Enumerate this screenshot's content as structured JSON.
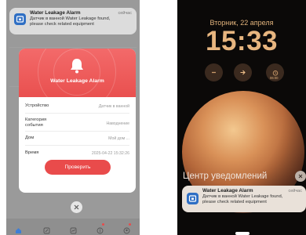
{
  "left": {
    "notification": {
      "title": "Water Leakage Alarm",
      "time": "сейчас",
      "body_line1": "Датчик в ванной Water Leakage found,",
      "body_line2": "please check related equipment"
    },
    "modal": {
      "title": "Water Leakage Alarm",
      "rows": [
        {
          "label": "Устройство",
          "value": "Датчик в ванной"
        },
        {
          "label": "Категория",
          "label2": "события",
          "value": "Наводнение"
        },
        {
          "label": "Дом",
          "value": "Мой дом ..."
        },
        {
          "label": "Время",
          "value": "2025-04-22 15:32:26"
        }
      ],
      "button": "Проверить"
    },
    "tabbar_icons": [
      "home-icon",
      "scene-icon",
      "stats-icon",
      "mall-icon",
      "profile-icon"
    ]
  },
  "right": {
    "date": "Вторник, 22 апреля",
    "time": "15:33",
    "widget_time": "06:00",
    "notification_center_label": "Центр уведомлений",
    "notification": {
      "title": "Water Leakage Alarm",
      "time": "сейчас",
      "body_line1": "Датчик в ванной Water Leakage found,",
      "body_line2": "please check related equipment"
    }
  },
  "colors": {
    "accent_red": "#e94b4b",
    "app_blue": "#2f6fc4",
    "clock_gold": "#e7b57f"
  }
}
